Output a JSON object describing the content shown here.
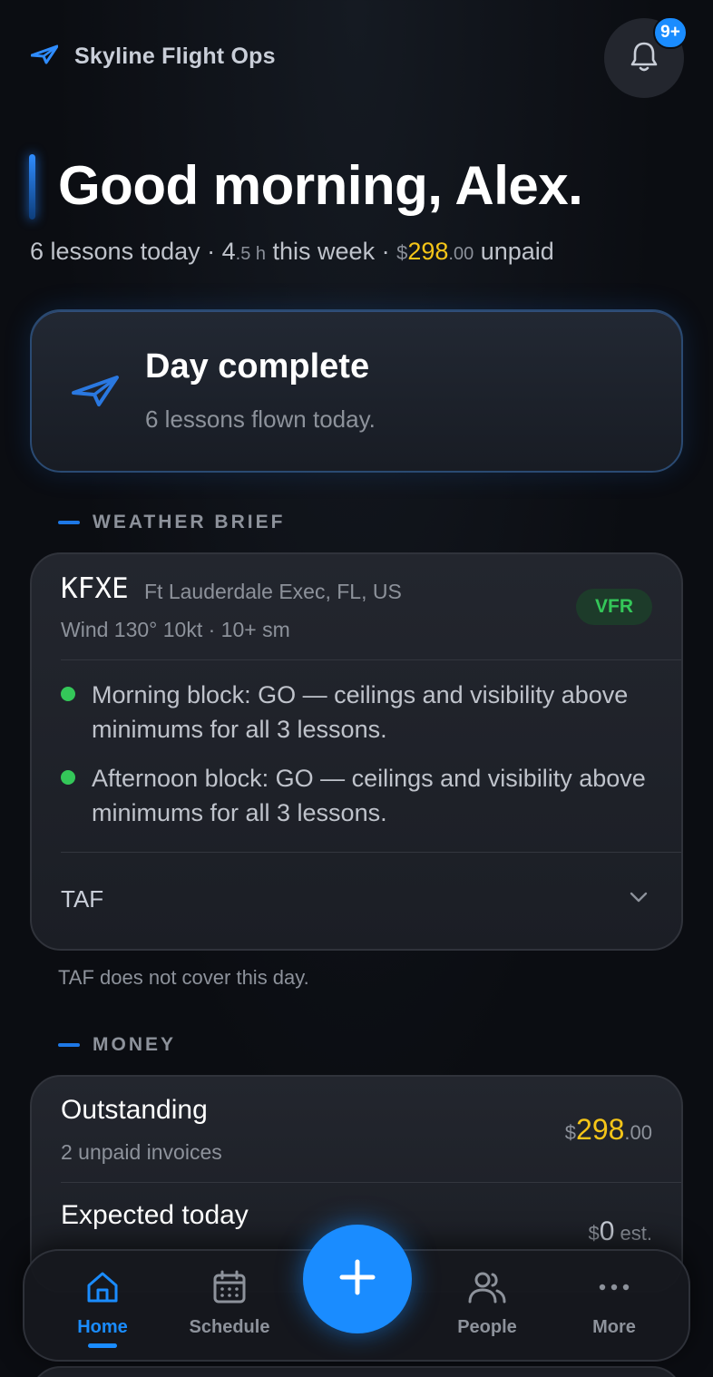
{
  "header": {
    "brand": "Skyline Flight Ops",
    "notifications_badge": "9+"
  },
  "greeting": "Good morning, Alex.",
  "summary": {
    "lessons": "6 lessons today",
    "sep1": " · ",
    "hours_int": "4",
    "hours_dec": ".5 h",
    "hours_label": " this week",
    "sep2": " · ",
    "currency": "$",
    "unpaid_int": "298",
    "unpaid_dec": ".00",
    "unpaid_label": " unpaid"
  },
  "day_card": {
    "title": "Day complete",
    "subtitle": "6 lessons flown today."
  },
  "weather": {
    "section_label": "WEATHER BRIEF",
    "station": "KFXE",
    "station_name": "Ft Lauderdale Exec, FL, US",
    "wind": "Wind 130° 10kt · 10+ sm",
    "category": "VFR",
    "briefs": [
      "Morning block: GO — ceilings and visibility above minimums for all 3 lessons.",
      "Afternoon block: GO — ceilings and visibility above minimums for all 3 lessons."
    ],
    "taf_label": "TAF",
    "taf_note": "TAF does not cover this day."
  },
  "money": {
    "section_label": "MONEY",
    "outstanding": {
      "title": "Outstanding",
      "subtitle": "2 unpaid invoices",
      "currency": "$",
      "amount_int": "298",
      "amount_dec": ".00"
    },
    "expected": {
      "title": "Expected today",
      "currency": "$",
      "amount": "0",
      "suffix": " est."
    }
  },
  "tabbar": {
    "home": "Home",
    "schedule": "Schedule",
    "people": "People",
    "more": "More"
  },
  "colors": {
    "accent": "#1a8cff",
    "gold": "#f5c518",
    "go_green": "#34c759"
  }
}
